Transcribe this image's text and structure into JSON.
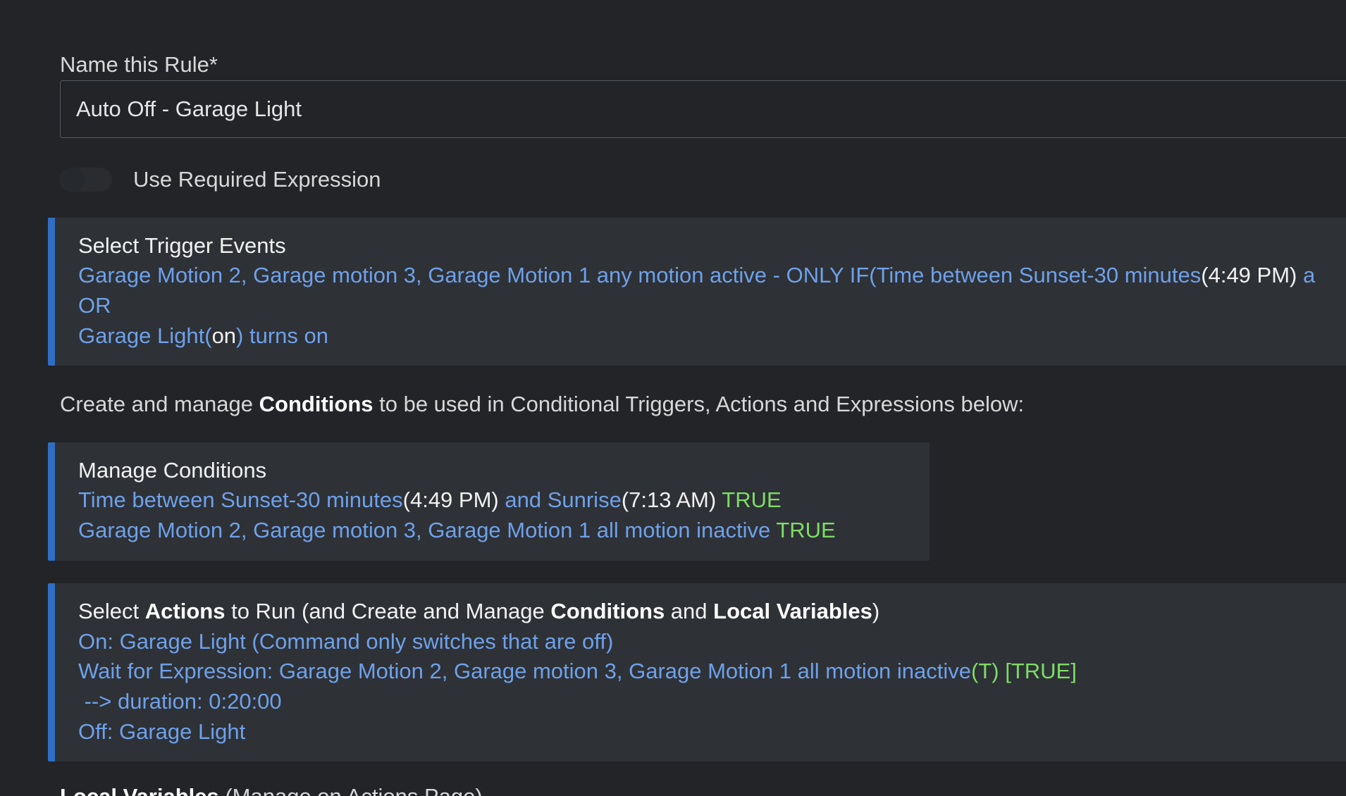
{
  "rule_name": {
    "label": "Name this Rule*",
    "value": "Auto Off - Garage Light"
  },
  "required_expression": {
    "label": "Use Required Expression",
    "enabled": false
  },
  "trigger_events": {
    "title": "Select Trigger Events",
    "line1_part1": "Garage Motion 2, Garage motion 3, Garage Motion 1 any motion active - ONLY IF(Time between Sunset-30 minutes",
    "line1_part2": "(4:49 PM)",
    "line1_part3": " a",
    "or_label": "OR",
    "line3_part1": "Garage Light(",
    "line3_part2": "on",
    "line3_part3": ") turns on"
  },
  "conditions_description": {
    "part1": "Create and manage ",
    "bold": "Conditions",
    "part2": " to be used in Conditional Triggers, Actions and Expressions below:"
  },
  "manage_conditions": {
    "title": "Manage Conditions",
    "cond1_part1": "Time between Sunset-30 minutes",
    "cond1_part2": "(4:49 PM)",
    "cond1_part3": " and Sunrise",
    "cond1_part4": "(7:13 AM)",
    "cond1_status": " TRUE",
    "cond2_text": "Garage Motion 2, Garage motion 3, Garage Motion 1 all motion inactive",
    "cond2_status": " TRUE"
  },
  "actions": {
    "title_part1": "Select ",
    "title_bold1": "Actions",
    "title_part2": " to Run (and Create and Manage ",
    "title_bold2": "Conditions",
    "title_part3": " and ",
    "title_bold3": "Local Variables",
    "title_part4": ")",
    "action1": "On: Garage Light (Command only switches that are off)",
    "action2_part1": "Wait for Expression: Garage Motion 2, Garage motion 3, Garage Motion 1 all motion inactive",
    "action2_part2": "(T) [TRUE]",
    "action3": " --> duration: 0:20:00",
    "action4": "Off: Garage Light"
  },
  "local_variables": {
    "bold": "Local Variables",
    "part": " (Manage on Actions Page)"
  }
}
